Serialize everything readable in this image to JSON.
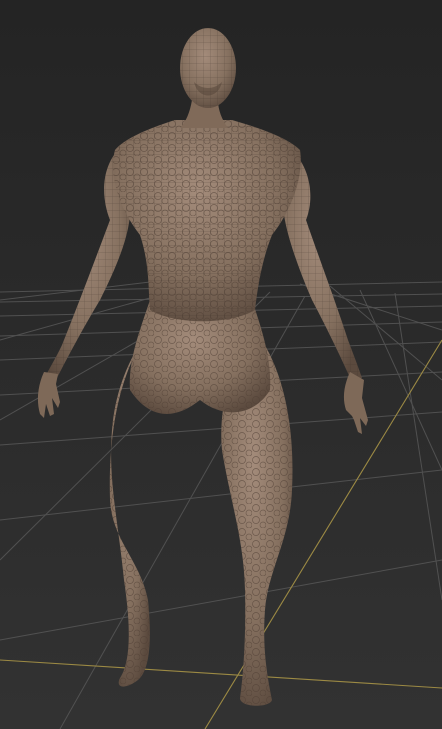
{
  "viewport": {
    "background_top": "#262626",
    "background_bottom": "#303030",
    "grid_color": "#5a5a5a",
    "axis_color": "#a08a3c"
  },
  "model": {
    "skin_color": "#8b7463",
    "skin_highlight": "#a89080",
    "skin_shadow": "#4e3e33",
    "wire_color": "#3a2e26"
  }
}
